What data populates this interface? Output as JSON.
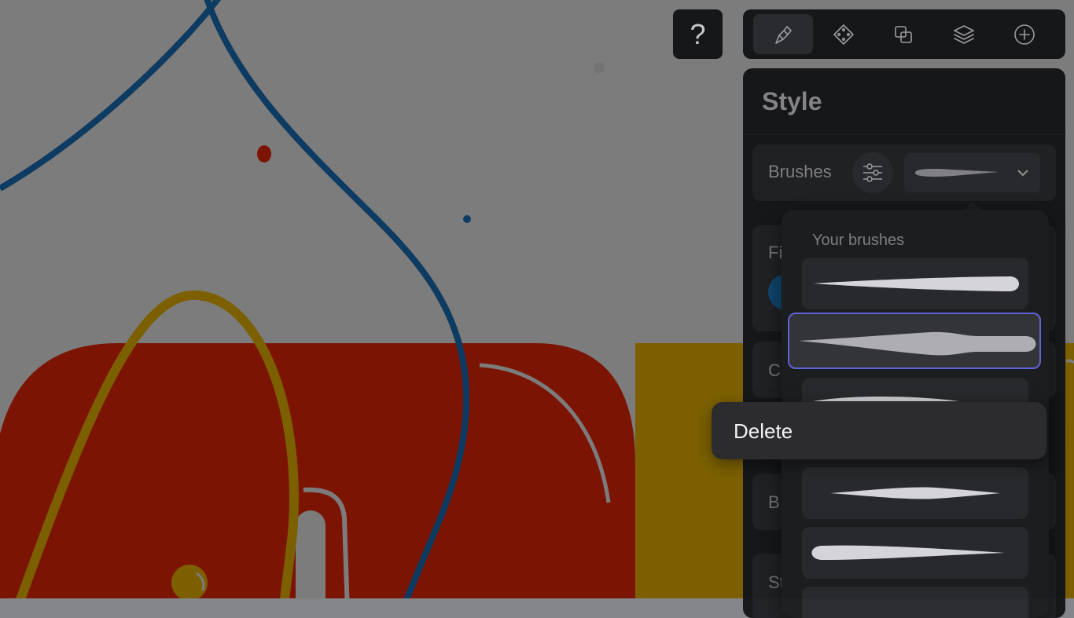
{
  "toolbar": {
    "help_label": "?",
    "tools": [
      {
        "name": "brush-icon",
        "active": true
      },
      {
        "name": "shape-icon",
        "active": false
      },
      {
        "name": "duplicate-icon",
        "active": false
      },
      {
        "name": "layers-icon",
        "active": false
      },
      {
        "name": "add-icon",
        "active": false
      }
    ]
  },
  "style_panel": {
    "title": "Style",
    "brushes_label": "Brushes",
    "settings_icon": "sliders-icon",
    "section_stubs": [
      "Fi",
      "C",
      "B",
      "St"
    ]
  },
  "brush_picker": {
    "title": "Your brushes",
    "selected_index": 1,
    "brushes": [
      {
        "name": "brush-taper-flat"
      },
      {
        "name": "brush-taper-wide"
      },
      {
        "name": "brush-partial"
      },
      {
        "name": "brush-leaf-thin"
      },
      {
        "name": "brush-taper-reverse"
      },
      {
        "name": "brush-partial-bottom"
      }
    ]
  },
  "context_menu": {
    "items": [
      {
        "label": "Delete"
      }
    ]
  },
  "colors": {
    "overlay": "#000000",
    "canvas_bg": "#ffffff",
    "red_shape": "#ff2b0a",
    "yellow_shape": "#ffc700",
    "blue_line": "#1f7ac9",
    "selection_border": "#6a6ae8",
    "panel_bg": "#18191b"
  }
}
